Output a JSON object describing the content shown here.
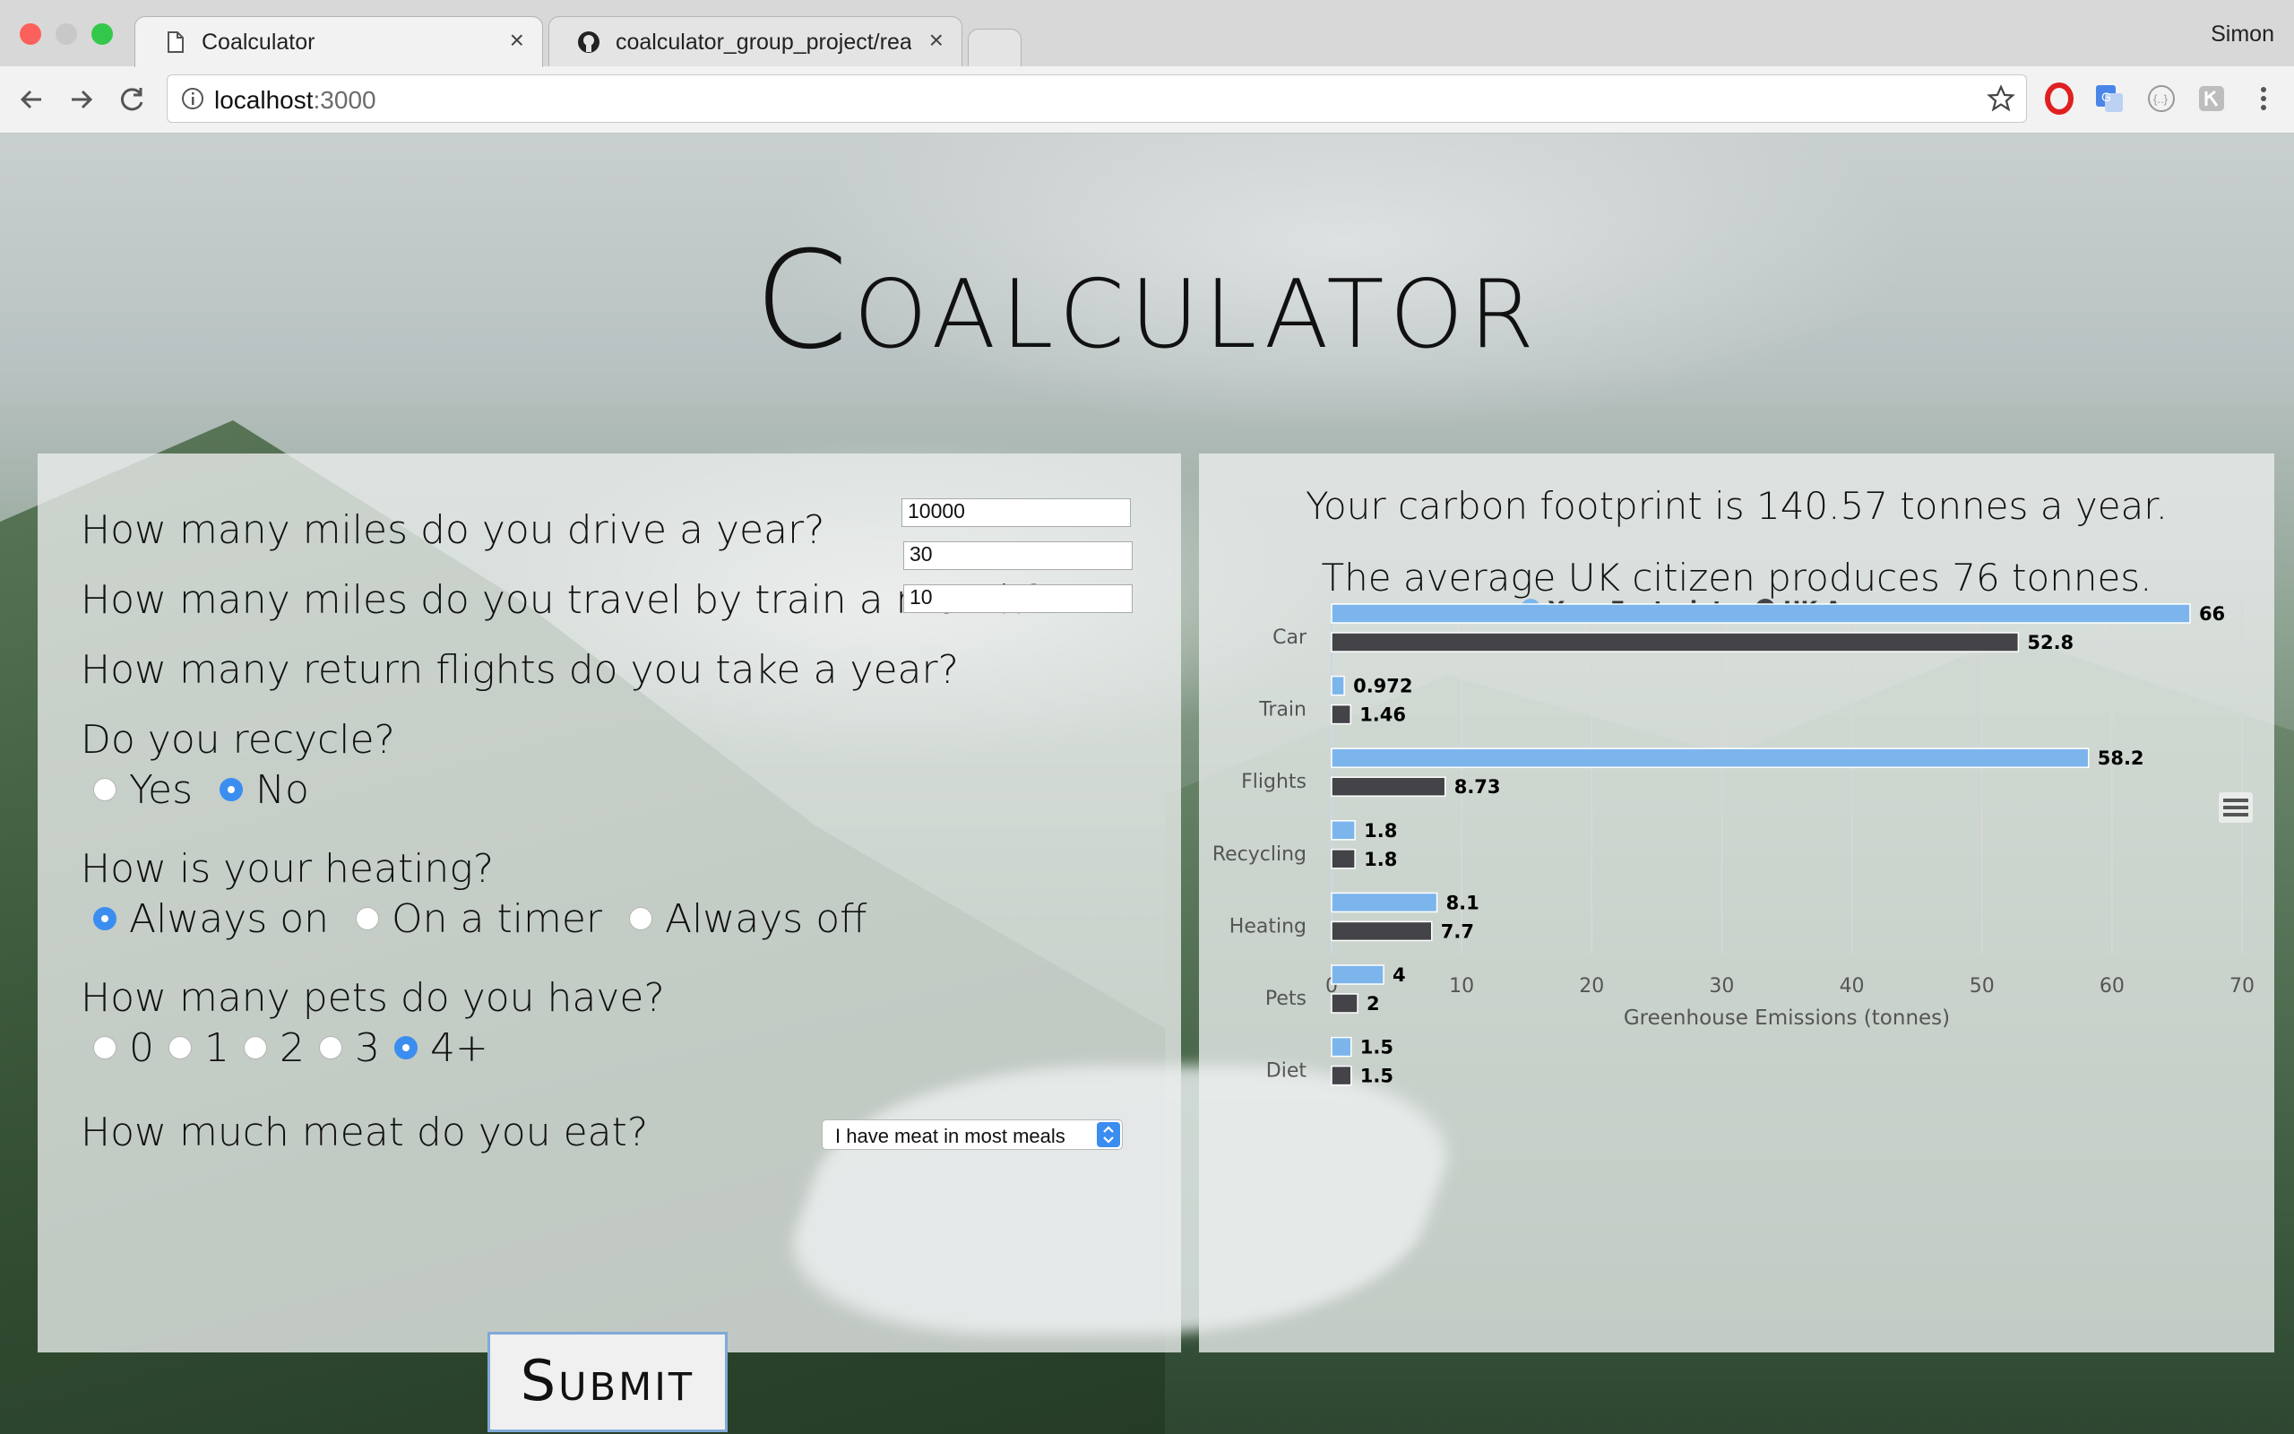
{
  "browser": {
    "tabs": [
      {
        "title": "Coalculator",
        "close": "×"
      },
      {
        "title": "coalculator_group_project/reac",
        "close": "×"
      }
    ],
    "user": "Simon",
    "url_host": "localhost",
    "url_port": ":3000"
  },
  "page": {
    "title": "Coalculator",
    "questions": {
      "drive": "How many miles do you drive a year?",
      "train": "How many miles do you travel by train a month?",
      "flights": "How many return flights do you take a year?",
      "recycle": "Do you recycle?",
      "heating": "How is your heating?",
      "pets": "How many pets do you have?",
      "meat": "How much meat do you eat?"
    },
    "inputs": {
      "drive": "10000",
      "train": "30",
      "flights": "10"
    },
    "recycle_options": {
      "yes": "Yes",
      "no": "No"
    },
    "heating_options": {
      "on": "Always on",
      "timer": "On a timer",
      "off": "Always off"
    },
    "pets_options": {
      "p0": "0",
      "p1": "1",
      "p2": "2",
      "p3": "3",
      "p4": "4+"
    },
    "meat_selected": "I have meat in most meals",
    "submit": "Submit",
    "result_line1": "Your carbon footprint is 140.57 tonnes a year.",
    "result_line2": "The average UK citizen produces 76 tonnes."
  },
  "colors": {
    "your": "#7cb5ec",
    "uk": "#434348",
    "accent": "#3b8ef0"
  },
  "chart_data": {
    "type": "bar",
    "orientation": "horizontal",
    "categories": [
      "Car",
      "Train",
      "Flights",
      "Recycling",
      "Heating",
      "Pets",
      "Diet"
    ],
    "series": [
      {
        "name": "Your Footprint",
        "values": [
          66,
          0.972,
          58.2,
          1.8,
          8.1,
          4,
          1.5
        ],
        "labels": [
          "66",
          "0.972",
          "58.2",
          "1.8",
          "8.1",
          "4",
          "1.5"
        ]
      },
      {
        "name": "UK Average",
        "values": [
          52.8,
          1.46,
          8.73,
          1.8,
          7.7,
          2,
          1.5
        ],
        "labels": [
          "52.8",
          "1.46",
          "8.73",
          "1.8",
          "7.7",
          "2",
          "1.5"
        ]
      }
    ],
    "xlabel": "Greenhouse Emissions (tonnes)",
    "xlim": [
      0,
      70
    ],
    "ticks": [
      "0",
      "10",
      "20",
      "30",
      "40",
      "50",
      "60",
      "70"
    ],
    "grid": true,
    "legend": "top-center"
  }
}
